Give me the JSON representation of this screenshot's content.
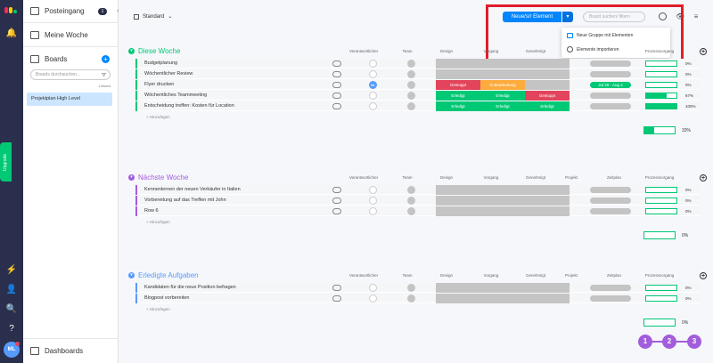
{
  "rail": {
    "upgrade": "Upgrade",
    "avatar": "ML"
  },
  "sidebar": {
    "inbox": "Posteingang",
    "inbox_count": "1",
    "my_week": "Meine Woche",
    "boards": "Boards",
    "search_placeholder": "Boards durchsuchen...",
    "board_count": "1 Board",
    "active_board": "Projektplan High Level",
    "dashboards": "Dashboards"
  },
  "topbar": {
    "view": "Standard",
    "new_item": "Neue/s/r Element",
    "search_placeholder": "Board suchen/ filtern"
  },
  "dropdown": {
    "new_group": "Neue Gruppe mit Elementen",
    "import": "Elemente importieren"
  },
  "columns": {
    "owner": "Verantwortlicher",
    "team": "Team",
    "design": "Design",
    "process": "Vorgang",
    "approved": "Genehmigt",
    "project": "Projekt",
    "timeline": "Zeitplan",
    "progress": "Prozessvorgang"
  },
  "groups": [
    {
      "title": "Diese Woche",
      "color": "#00c875",
      "add": "+ Hinzufügen",
      "summary": "33%",
      "rows": [
        {
          "name": "Budgetplanung",
          "design": "",
          "process": "",
          "approved": "",
          "timeline": "",
          "pct": "0%"
        },
        {
          "name": "Wöchentlicher Review",
          "design": "",
          "process": "",
          "approved": "",
          "timeline": "",
          "pct": "0%"
        },
        {
          "name": "Flyer drucken",
          "owner": "ML",
          "design": "Gestoppt",
          "process": "In Bearbeitung",
          "approved": "",
          "timeline": "Jul 28 - Aug 4",
          "pct": "0%"
        },
        {
          "name": "Wöchentliches Teammeeting",
          "design": "Erledigt",
          "process": "Erledigt",
          "approved": "Gestoppt",
          "timeline": "",
          "pct": "67%"
        },
        {
          "name": "Entscheidung treffen: Kosten für Location",
          "design": "Erledigt",
          "process": "Erledigt",
          "approved": "Erledigt",
          "timeline": "",
          "pct": "100%"
        }
      ]
    },
    {
      "title": "Nächste Woche",
      "color": "#a25ddc",
      "add": "+ Hinzufügen",
      "summary": "0%",
      "rows": [
        {
          "name": "Kennenlernen der neuen Verkäufer in Italien",
          "pct": "0%"
        },
        {
          "name": "Vorbereitung auf das Treffen mit John",
          "pct": "0%"
        },
        {
          "name": "Row 6",
          "pct": "0%"
        }
      ]
    },
    {
      "title": "Erledigte Aufgaben",
      "color": "#579bfc",
      "add": "+ Hinzufügen",
      "summary": "0%",
      "rows": [
        {
          "name": "Kandidaten für die neue Position befragen",
          "pct": "0%"
        },
        {
          "name": "Blogpost vorbereiten",
          "pct": "0%"
        }
      ]
    }
  ],
  "markers": [
    "1",
    "2",
    "3"
  ],
  "status_colors": {
    "Erledigt": "#00c875",
    "Gestoppt": "#e2445c",
    "In Bearbeitung": "#fdab3d",
    "empty": "#c4c4c4"
  }
}
